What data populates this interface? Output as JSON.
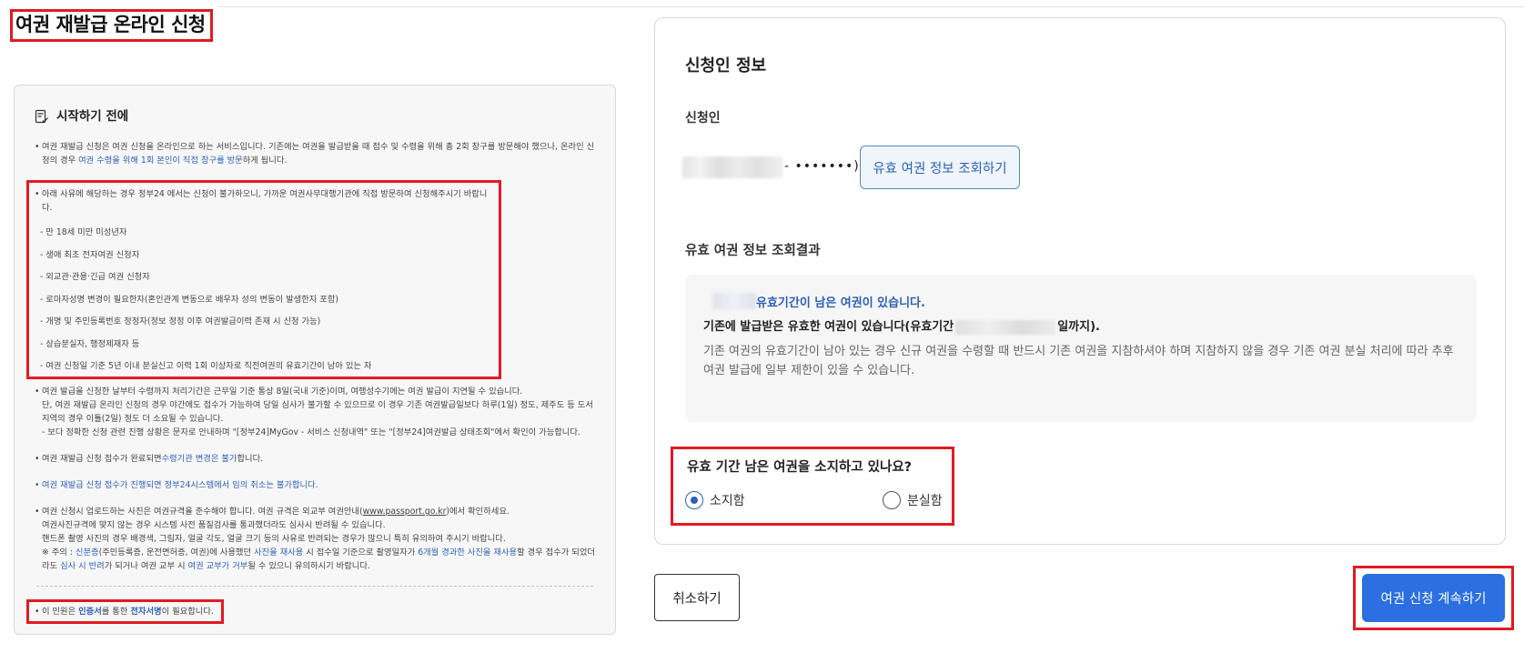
{
  "page": {
    "title": "여권 재발급 온라인 신청"
  },
  "left": {
    "head_title": "시작하기 전에",
    "notice1_a": "여권 재발급 신청은 여권 신청을 온라인으로 하는 서비스입니다. 기존에는 여권을 발급받을 때 접수 및 수령을 위해 총 2회 창구를 방문해야 했으나, 온라인 신청의 경우 ",
    "notice1_b": "여권 수령을 위해 1회 본인이 직접 창구를 방문",
    "notice1_c": "하게 됩니다.",
    "restrict_intro": "아래 사유에 해당하는 경우 정부24 에서는 신청이 불가하오니, 가까운 여권사무대행기관에 직접 방문하여 신청해주시기 바랍니다.",
    "restrict_items": [
      "- 만 18세 미만 미성년자",
      "- 생애 최초 전자여권 신청자",
      "- 외교관·관용·긴급 여권 신청자",
      "- 로마자성명 변경이 필요한자(혼인관계 변동으로 배우자 성의 변동이 발생한자 포함)",
      "- 개명 및 주민등록번호 정정자(정보 정정 이후 여권발급이력 존재 시 신청 가능)",
      "- 상습분실자, 행정제재자 등",
      "- 여권 신청일 기준 5년 이내 분실신고 이력 1회 이상자로 직전여권의 유효기간이 남아 있는 자"
    ],
    "notice3_l1": "여권 발급을 신청한 날부터 수령까지 처리기간은 근무일 기준 통상 8일(국내 기준)이며, 여행성수기에는 여권 발급이 지연될 수 있습니다.",
    "notice3_l2": "단, 여권 재발급 온라인 신청의 경우 야간에도 접수가 가능하여 당일 심사가 불가할 수 있으므로 이 경우 기존 여권발급일보다 하루(1일) 정도, 제주도 등 도서지역의 경우 이틀(2일) 정도 더 소요될 수 있습니다.",
    "notice3_l3": "- 보다 정확한 신청 관련 진행 상황은 문자로 안내하며 \"[정부24]MyGov - 서비스 신청내역\" 또는 \"[정부24]여권발급 상태조회\"에서 확인이 가능합니다.",
    "notice4_a": "여권 재발급 신청 접수가 완료되면",
    "notice4_b": "수령기관 변경은 불가",
    "notice4_c": "합니다.",
    "notice5": "여권 재발급 신청 접수가 진행되면 정부24시스템에서 임의 취소는 불가합니다.",
    "notice6_l1a": "여권 신청시 업로드하는 사진은 여권규격을 준수해야 합니다. 여권 규격은 외교부 여권안내(",
    "notice6_link": "www.passport.go.kr",
    "notice6_l1b": ")에서 확인하세요.",
    "notice6_l2": "여권사진규격에 맞지 않는 경우 시스템 사전 품질검사를 통과했더라도 심사시 반려될 수 있습니다.",
    "notice6_l3": "핸드폰 촬영 사진의 경우 배경색, 그림자, 얼굴 각도, 얼굴 크기 등의 사유로 반려되는 경우가 많으니 특히 유의하여 주시기 바랍니다.",
    "notice6_l4a": "※ 주의 : ",
    "notice6_l4b": "신분증",
    "notice6_l4c": "(주민등록증, 운전면허증, 여권)에 사용했던 ",
    "notice6_l4d": "사진을 재사용",
    "notice6_l4e": " 시 접수일 기준으로 촬영일자가 ",
    "notice6_l4f": "6개월 경과한 사진을 재사용",
    "notice6_l4g": "할 경우 접수가 되었더라도 ",
    "notice6_l4h": "심사 시 반려",
    "notice6_l4i": "가 되거나 여권 교부 시 ",
    "notice6_l4j": "여권 교부가 거부",
    "notice6_l4k": "될 수 있으니 유의하시기 바랍니다.",
    "cert_a": "이 민원은 ",
    "cert_b": "인증서",
    "cert_c": "를 통한 ",
    "cert_d": "전자서명",
    "cert_e": "이 필요합니다."
  },
  "right": {
    "title": "신청인 정보",
    "applicant_label": "신청인",
    "id_suffix": "- •••••••)",
    "lookup_button": "유효 여권 정보 조회하기",
    "result_title": "유효 여권 정보 조회결과",
    "result_line1": "유효기간이 남은 여권이 있습니다.",
    "result_line2_a": "기존에 발급받은 유효한 여권이 있습니다(유효기간",
    "result_line2_b": "일까지).",
    "result_desc": "기존 여권의 유효기간이 남아 있는 경우 신규 여권을 수령할 때 반드시 기존 여권을 지참하셔야 하며 지참하지 않을 경우 기존 여권 분실 처리에 따라 추후 여권 발급에 일부 제한이 있을 수 있습니다.",
    "question": "유효 기간 남은 여권을 소지하고 있나요?",
    "option1": "소지함",
    "option2": "분실함",
    "selected": "소지함"
  },
  "footer": {
    "cancel_button": "취소하기",
    "continue_button": "여권 신청 계속하기"
  },
  "colors": {
    "accent": "#2b6fe0",
    "highlight": "#e01b22",
    "link": "#2d5fb4"
  }
}
